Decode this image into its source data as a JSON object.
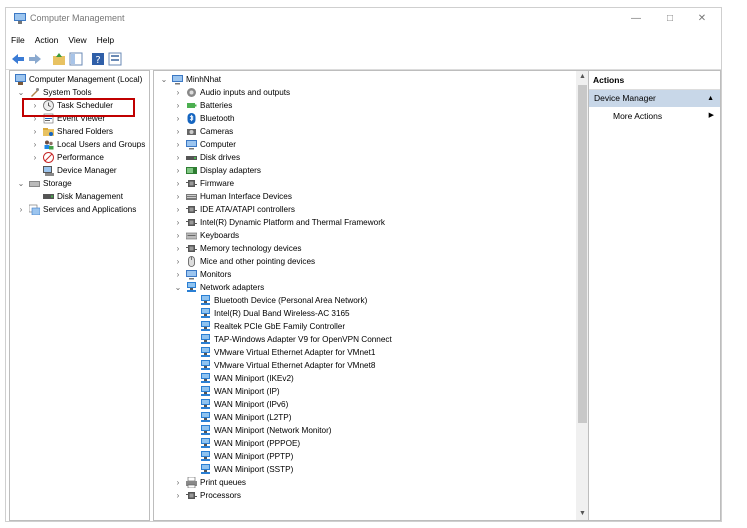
{
  "window": {
    "title": "Computer Management"
  },
  "menu": [
    "File",
    "Action",
    "View",
    "Help"
  ],
  "left_tree": [
    {
      "label": "Computer Management (Local)",
      "level": 0,
      "chev": "",
      "icon": "computer-management-icon"
    },
    {
      "label": "System Tools",
      "level": 1,
      "chev": "⌄",
      "icon": "tools-icon"
    },
    {
      "label": "Task Scheduler",
      "level": 2,
      "chev": "›",
      "icon": "clock-icon"
    },
    {
      "label": "Event Viewer",
      "level": 2,
      "chev": "›",
      "icon": "event-viewer-icon"
    },
    {
      "label": "Shared Folders",
      "level": 2,
      "chev": "›",
      "icon": "shared-folder-icon"
    },
    {
      "label": "Local Users and Groups",
      "level": 2,
      "chev": "›",
      "icon": "users-icon"
    },
    {
      "label": "Performance",
      "level": 2,
      "chev": "›",
      "icon": "performance-icon"
    },
    {
      "label": "Device Manager",
      "level": 2,
      "chev": "",
      "icon": "device-manager-icon"
    },
    {
      "label": "Storage",
      "level": 1,
      "chev": "⌄",
      "icon": "storage-icon"
    },
    {
      "label": "Disk Management",
      "level": 2,
      "chev": "",
      "icon": "disk-icon"
    },
    {
      "label": "Services and Applications",
      "level": 1,
      "chev": "›",
      "icon": "services-icon"
    }
  ],
  "device_tree": [
    {
      "label": "MinhNhat",
      "level": 0,
      "chev": "⌄",
      "icon": "computer-icon"
    },
    {
      "label": "Audio inputs and outputs",
      "level": 1,
      "chev": "›",
      "icon": "audio-icon"
    },
    {
      "label": "Batteries",
      "level": 1,
      "chev": "›",
      "icon": "battery-icon"
    },
    {
      "label": "Bluetooth",
      "level": 1,
      "chev": "›",
      "icon": "bluetooth-icon"
    },
    {
      "label": "Cameras",
      "level": 1,
      "chev": "›",
      "icon": "camera-icon"
    },
    {
      "label": "Computer",
      "level": 1,
      "chev": "›",
      "icon": "monitor-icon"
    },
    {
      "label": "Disk drives",
      "level": 1,
      "chev": "›",
      "icon": "disk-drive-icon"
    },
    {
      "label": "Display adapters",
      "level": 1,
      "chev": "›",
      "icon": "display-adapter-icon"
    },
    {
      "label": "Firmware",
      "level": 1,
      "chev": "›",
      "icon": "firmware-icon"
    },
    {
      "label": "Human Interface Devices",
      "level": 1,
      "chev": "›",
      "icon": "hid-icon"
    },
    {
      "label": "IDE ATA/ATAPI controllers",
      "level": 1,
      "chev": "›",
      "icon": "ide-icon"
    },
    {
      "label": "Intel(R) Dynamic Platform and Thermal Framework",
      "level": 1,
      "chev": "›",
      "icon": "chip-icon"
    },
    {
      "label": "Keyboards",
      "level": 1,
      "chev": "›",
      "icon": "keyboard-icon"
    },
    {
      "label": "Memory technology devices",
      "level": 1,
      "chev": "›",
      "icon": "memory-icon"
    },
    {
      "label": "Mice and other pointing devices",
      "level": 1,
      "chev": "›",
      "icon": "mouse-icon"
    },
    {
      "label": "Monitors",
      "level": 1,
      "chev": "›",
      "icon": "monitor-icon"
    },
    {
      "label": "Network adapters",
      "level": 1,
      "chev": "⌄",
      "icon": "network-icon"
    },
    {
      "label": "Bluetooth Device (Personal Area Network)",
      "level": 2,
      "chev": "",
      "icon": "network-icon"
    },
    {
      "label": "Intel(R) Dual Band Wireless-AC 3165",
      "level": 2,
      "chev": "",
      "icon": "network-icon"
    },
    {
      "label": "Realtek PCIe GbE Family Controller",
      "level": 2,
      "chev": "",
      "icon": "network-icon"
    },
    {
      "label": "TAP-Windows Adapter V9 for OpenVPN Connect",
      "level": 2,
      "chev": "",
      "icon": "network-icon"
    },
    {
      "label": "VMware Virtual Ethernet Adapter for VMnet1",
      "level": 2,
      "chev": "",
      "icon": "network-icon"
    },
    {
      "label": "VMware Virtual Ethernet Adapter for VMnet8",
      "level": 2,
      "chev": "",
      "icon": "network-icon"
    },
    {
      "label": "WAN Miniport (IKEv2)",
      "level": 2,
      "chev": "",
      "icon": "network-icon"
    },
    {
      "label": "WAN Miniport (IP)",
      "level": 2,
      "chev": "",
      "icon": "network-icon"
    },
    {
      "label": "WAN Miniport (IPv6)",
      "level": 2,
      "chev": "",
      "icon": "network-icon"
    },
    {
      "label": "WAN Miniport (L2TP)",
      "level": 2,
      "chev": "",
      "icon": "network-icon"
    },
    {
      "label": "WAN Miniport (Network Monitor)",
      "level": 2,
      "chev": "",
      "icon": "network-icon"
    },
    {
      "label": "WAN Miniport (PPPOE)",
      "level": 2,
      "chev": "",
      "icon": "network-icon"
    },
    {
      "label": "WAN Miniport (PPTP)",
      "level": 2,
      "chev": "",
      "icon": "network-icon"
    },
    {
      "label": "WAN Miniport (SSTP)",
      "level": 2,
      "chev": "",
      "icon": "network-icon"
    },
    {
      "label": "Print queues",
      "level": 1,
      "chev": "›",
      "icon": "printer-icon"
    },
    {
      "label": "Processors",
      "level": 1,
      "chev": "›",
      "icon": "processor-icon"
    }
  ],
  "actions": {
    "header": "Actions",
    "section": "Device Manager",
    "item": "More Actions"
  },
  "colors": {
    "accent": "#c8d7e8",
    "highlight_border": "#c00000",
    "icon_blue": "#2a7fd4"
  }
}
